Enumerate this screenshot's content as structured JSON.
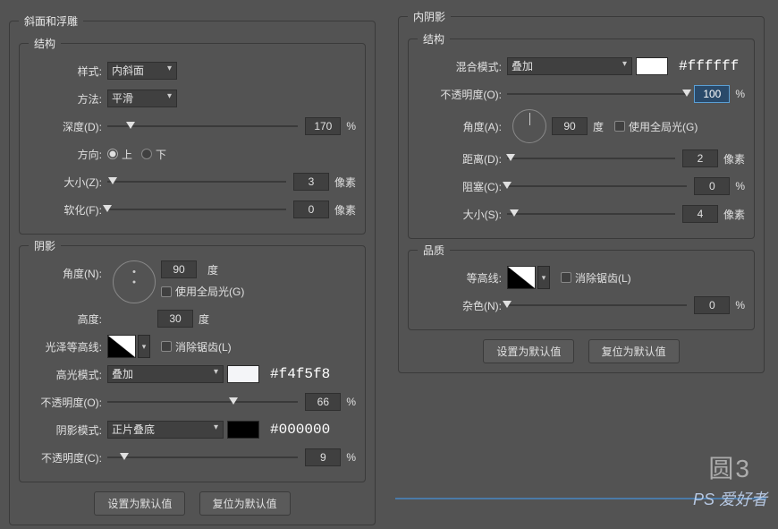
{
  "bevel": {
    "title": "斜面和浮雕",
    "sect_structure": "结构",
    "style_label": "样式:",
    "style_value": "内斜面",
    "technique_label": "方法:",
    "technique_value": "平滑",
    "depth_label": "深度(D):",
    "depth_value": "170",
    "depth_unit": "%",
    "direction_label": "方向:",
    "direction_up": "上",
    "direction_down": "下",
    "size_label": "大小(Z):",
    "size_value": "3",
    "size_unit": "像素",
    "soften_label": "软化(F):",
    "soften_value": "0",
    "soften_unit": "像素",
    "sect_shading": "阴影",
    "angle_label": "角度(N):",
    "angle_value": "90",
    "angle_unit": "度",
    "use_global": "使用全局光(G)",
    "altitude_label": "高度:",
    "altitude_value": "30",
    "altitude_unit": "度",
    "gloss_label": "光泽等高线:",
    "antialias": "消除锯齿(L)",
    "highlight_mode_label": "高光模式:",
    "highlight_mode_value": "叠加",
    "highlight_color": "#f4f5f8",
    "highlight_opacity_label": "不透明度(O):",
    "highlight_opacity_value": "66",
    "highlight_opacity_unit": "%",
    "shadow_mode_label": "阴影模式:",
    "shadow_mode_value": "正片叠底",
    "shadow_color": "#000000",
    "shadow_opacity_label": "不透明度(C):",
    "shadow_opacity_value": "9",
    "shadow_opacity_unit": "%"
  },
  "inner_shadow": {
    "title": "内阴影",
    "sect_structure": "结构",
    "blend_label": "混合模式:",
    "blend_value": "叠加",
    "blend_color": "#ffffff",
    "opacity_label": "不透明度(O):",
    "opacity_value": "100",
    "opacity_unit": "%",
    "angle_label": "角度(A):",
    "angle_value": "90",
    "angle_unit": "度",
    "use_global": "使用全局光(G)",
    "distance_label": "距离(D):",
    "distance_value": "2",
    "distance_unit": "像素",
    "choke_label": "阻塞(C):",
    "choke_value": "0",
    "choke_unit": "%",
    "size_label": "大小(S):",
    "size_value": "4",
    "size_unit": "像素",
    "sect_quality": "品质",
    "contour_label": "等高线:",
    "antialias": "消除锯齿(L)",
    "noise_label": "杂色(N):",
    "noise_value": "0",
    "noise_unit": "%"
  },
  "buttons": {
    "default": "设置为默认值",
    "reset": "复位为默认值"
  },
  "watermark": {
    "label1": "圆3",
    "label2": "PS 爱好者"
  }
}
